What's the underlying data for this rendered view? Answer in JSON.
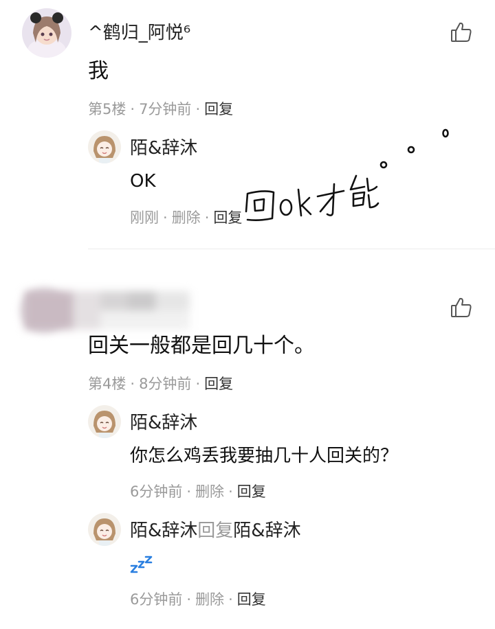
{
  "comments": [
    {
      "author": "^鹤归_阿悦⁶",
      "text": "我",
      "meta": {
        "floor": "第5楼",
        "time": "7分钟前",
        "reply": "回复"
      },
      "replies": [
        {
          "author": "陌&辞沐",
          "text": "OK",
          "meta": {
            "time": "刚刚",
            "delete": "删除",
            "reply": "回复"
          }
        }
      ]
    },
    {
      "author": "",
      "text": "回关一般都是回几十个。",
      "meta": {
        "floor": "第4楼",
        "time": "8分钟前",
        "reply": "回复"
      },
      "replies": [
        {
          "author": "陌&辞沐",
          "text": "你怎么鸡丢我要抽几十人回关的？",
          "meta": {
            "time": "6分钟前",
            "delete": "删除",
            "reply": "回复"
          }
        },
        {
          "author": "陌&辞沐",
          "reply_word": "回复",
          "reply_target": "陌&辞沐",
          "text": "💤",
          "meta": {
            "time": "6分钟前",
            "delete": "删除",
            "reply": "回复"
          }
        }
      ]
    }
  ],
  "handwriting": "回ok才能。。。",
  "dot": "·",
  "icons": {
    "like": "thumbs-up-icon"
  }
}
